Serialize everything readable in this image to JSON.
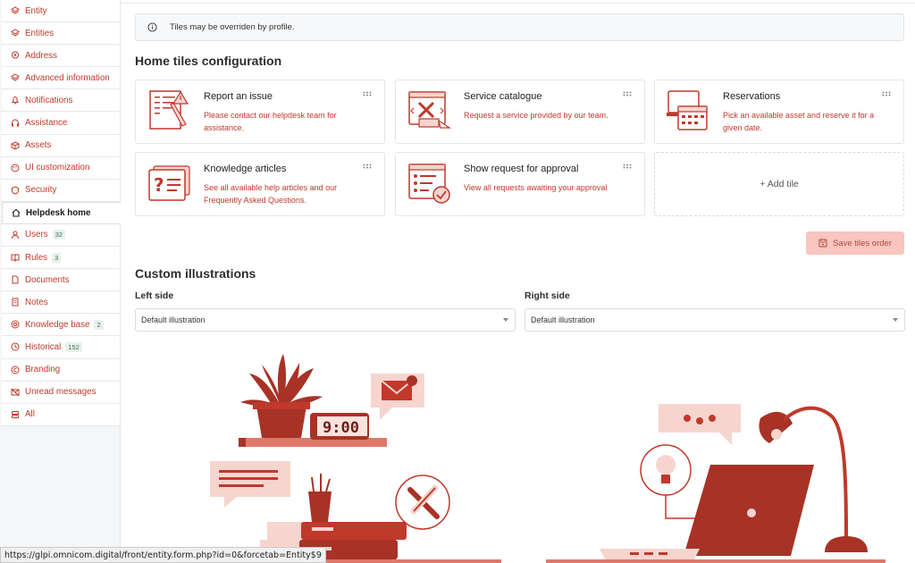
{
  "sidebar": {
    "items": [
      {
        "label": "Entity",
        "icon": "layers-icon"
      },
      {
        "label": "Entities",
        "icon": "layers-icon"
      },
      {
        "label": "Address",
        "icon": "map-pin-icon"
      },
      {
        "label": "Advanced information",
        "icon": "layers-icon"
      },
      {
        "label": "Notifications",
        "icon": "bell-icon"
      },
      {
        "label": "Assistance",
        "icon": "headset-icon"
      },
      {
        "label": "Assets",
        "icon": "package-icon"
      },
      {
        "label": "UI customization",
        "icon": "palette-icon"
      },
      {
        "label": "Security",
        "icon": "shield-icon"
      },
      {
        "label": "Helpdesk home",
        "icon": "home-icon",
        "active": true
      },
      {
        "label": "Users",
        "icon": "user-icon",
        "badge": "32"
      },
      {
        "label": "Rules",
        "icon": "book-icon",
        "badge": "3"
      },
      {
        "label": "Documents",
        "icon": "file-icon"
      },
      {
        "label": "Notes",
        "icon": "note-icon"
      },
      {
        "label": "Knowledge base",
        "icon": "lifebuoy-icon",
        "badge": "2"
      },
      {
        "label": "Historical",
        "icon": "history-icon",
        "badge": "152"
      },
      {
        "label": "Branding",
        "icon": "copyright-icon"
      },
      {
        "label": "Unread messages",
        "icon": "mail-off-icon"
      },
      {
        "label": "All",
        "icon": "stack-icon"
      }
    ]
  },
  "alert": {
    "text": "Tiles may be overriden by profile."
  },
  "tiles_section": {
    "title": "Home tiles configuration",
    "tiles": [
      {
        "title": "Report an issue",
        "desc": "Please contact our helpdesk team for assistance."
      },
      {
        "title": "Service catalogue",
        "desc": "Request a service provided by our team."
      },
      {
        "title": "Reservations",
        "desc": "Pick an available asset and reserve it for a given date."
      },
      {
        "title": "Knowledge articles",
        "desc": "See all available help articles and our Frequently Asked Questions."
      },
      {
        "title": "Show request for approval",
        "desc": "View all requests awaiting your approval"
      }
    ],
    "add_tile": "+ Add tile",
    "save_label": "Save tiles order"
  },
  "illustrations": {
    "title": "Custom illustrations",
    "left_label": "Left side",
    "right_label": "Right side",
    "left_value": "Default illustration",
    "right_value": "Default illustration",
    "clock_text": "9:00"
  },
  "status_url": "https://glpi.omnicom.digital/front/entity.form.php?id=0&forcetab=Entity$9",
  "colors": {
    "accent": "#c0392b",
    "illustration_dark": "#a83226",
    "illustration_light": "#f6d5cf"
  }
}
